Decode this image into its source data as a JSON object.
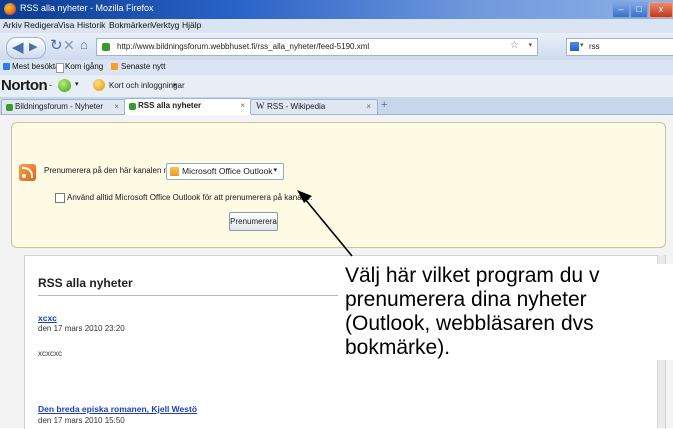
{
  "window": {
    "title": "RSS alla nyheter - Mozilla Firefox"
  },
  "menu": [
    "Arkiv",
    "Redigera",
    "Visa",
    "Historik",
    "Bokmärken",
    "Verktyg",
    "Hjälp"
  ],
  "nav": {
    "url": "http://www.bildningsforum.webbhuset.fi/rss_alla_nyheter/feed-5190.xml",
    "search_value": "rss"
  },
  "bookmarks": [
    "Mest besökta",
    "Kom igång",
    "Senaste nytt"
  ],
  "norton": {
    "brand": "Norton",
    "dash": "-",
    "login_label": "Kort och inloggningar"
  },
  "tabs": [
    {
      "label": "Bildningsforum - Nyheter",
      "active": false
    },
    {
      "label": "RSS alla nyheter",
      "active": true
    },
    {
      "label": "RSS - Wikipedia",
      "active": false
    }
  ],
  "subscribe": {
    "prompt": "Prenumerera på den här kanalen med",
    "selected_reader": "Microsoft Office Outlook",
    "always_use": "Använd alltid Microsoft Office Outlook för att prenumerera på kanaler.",
    "button": "Prenumerera"
  },
  "feed": {
    "title": "RSS alla nyheter",
    "items": [
      {
        "title": "xcxc",
        "date": "den 17 mars 2010 23:20",
        "body": "xcxcxc"
      },
      {
        "title": "Den breda episka romanen, Kjell Westö",
        "date": "den 17 mars 2010 15:50",
        "body": ""
      }
    ]
  },
  "annotation": {
    "lines": [
      "Välj här vilket program du v",
      "prenumerera dina nyheter",
      "(Outlook, webbläsaren dvs",
      "bokmärke)."
    ]
  },
  "colors": {
    "titlebar": "#2a62c7",
    "subscribe_panel": "#fdfbe4",
    "link": "#1a3fb8",
    "rss_orange": "#e2621a"
  }
}
